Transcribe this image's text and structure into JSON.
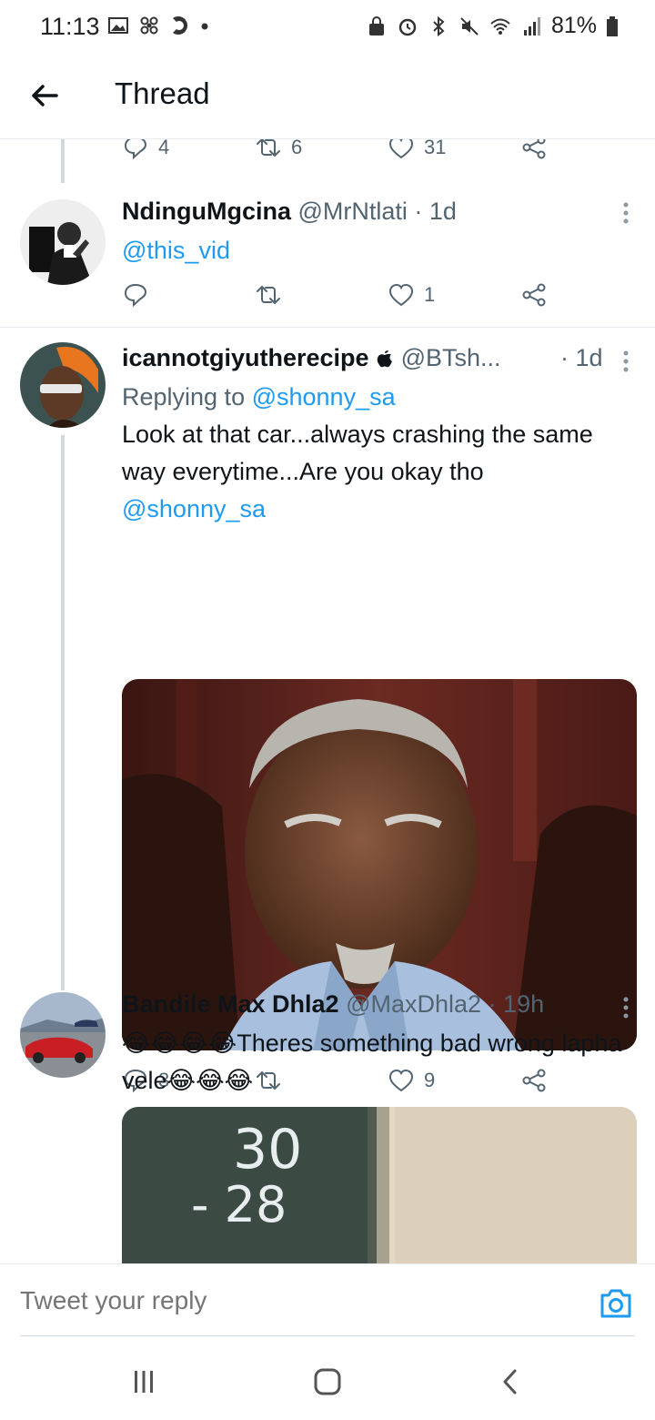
{
  "status_bar": {
    "time": "11:13",
    "battery": "81%"
  },
  "header": {
    "title": "Thread"
  },
  "top_actions": {
    "reply_count": "4",
    "retweet_count": "6",
    "like_count": "31"
  },
  "tweets": [
    {
      "name": "NdinguMgcina",
      "meta": "@MrNtlati · 1d",
      "text": "@this_vid",
      "reply_count": "",
      "retweet_count": "",
      "like_count": "1"
    },
    {
      "name": "icannotgiyutherecipe",
      "handle": "@BTsh...",
      "time": "· 1d",
      "replying_prefix": "Replying to ",
      "replying_to": "@shonny_sa",
      "text": "Look at that car...always crashing the same way everytime...Are you okay tho ",
      "mention": "@shonny_sa",
      "reply_count": "3",
      "retweet_count": "",
      "like_count": "9"
    },
    {
      "name": "Bandile Max Dhla2",
      "meta": "@MaxDhla2 · 19h",
      "text_emoji_lead": "😂😂😂😂",
      "text": "Theres something bad wrong lapha vele",
      "text_emoji_tail": "😂😂😂",
      "media_text_1": "30",
      "media_text_2": "- 28"
    }
  ],
  "reply_bar": {
    "placeholder": "Tweet your reply"
  },
  "colors": {
    "link": "#1d9bf0",
    "secondary_text": "#536471",
    "divider": "#e6ecf0"
  }
}
